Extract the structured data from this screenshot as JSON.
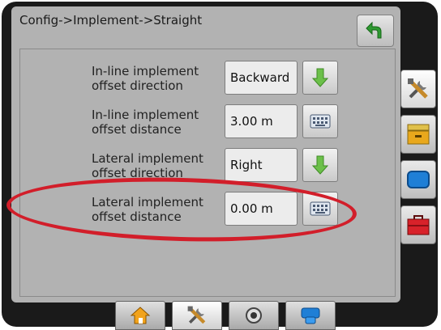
{
  "header": {
    "title": "Config->Implement->Straight"
  },
  "rows": [
    {
      "label_line1": "In-line implement",
      "label_line2": "offset direction",
      "value": "Backward",
      "control": "arrow-down-icon"
    },
    {
      "label_line1": "In-line implement",
      "label_line2": "offset distance",
      "value": "3.00 m",
      "control": "keyboard-icon"
    },
    {
      "label_line1": "Lateral implement",
      "label_line2": "offset direction",
      "value": "Right",
      "control": "arrow-down-icon"
    },
    {
      "label_line1": "Lateral implement",
      "label_line2": "offset distance",
      "value": "0.00 m",
      "control": "keyboard-icon"
    }
  ],
  "side_buttons": [
    "tools-icon",
    "storage-icon",
    "display-icon",
    "toolbox-icon"
  ],
  "tabs": [
    "home-icon",
    "tools-icon",
    "gps-icon",
    "guidance-icon"
  ],
  "colors": {
    "highlight": "#d21e2a",
    "arrow_green": "#6cc04a",
    "screen_bg": "#b2b2b2"
  }
}
